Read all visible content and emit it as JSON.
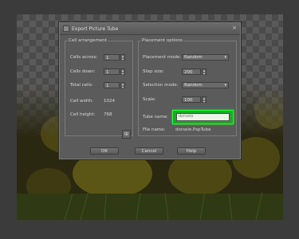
{
  "dialog": {
    "title": "Export Picture Tube",
    "close_glyph": "×",
    "cell_arrangement": {
      "group_title": "Cell arrangement",
      "cells_across_label": "Cells across:",
      "cells_across_value": "1",
      "cells_down_label": "Cells down:",
      "cells_down_value": "1",
      "total_cells_label": "Total cells:",
      "total_cells_value": "1",
      "cell_width_label": "Cell width:",
      "cell_width_value": "1024",
      "cell_height_label": "Cell height:",
      "cell_height_value": "768"
    },
    "placement_options": {
      "group_title": "Placement options",
      "placement_mode_label": "Placement mode:",
      "placement_mode_value": "Random",
      "step_size_label": "Step size:",
      "step_size_value": "200",
      "selection_mode_label": "Selection mode:",
      "selection_mode_value": "Random",
      "scale_label": "Scale:",
      "scale_value": "100",
      "tube_name_label": "Tube name:",
      "tube_name_value": "dorsele",
      "file_name_label": "File name:",
      "file_name_value": "dorsele.PspTube"
    },
    "buttons": {
      "ok": "OK",
      "cancel": "Cancel",
      "help": "Help"
    },
    "icon_button_glyph": "⊞",
    "highlight_color": "#1fa52a"
  }
}
